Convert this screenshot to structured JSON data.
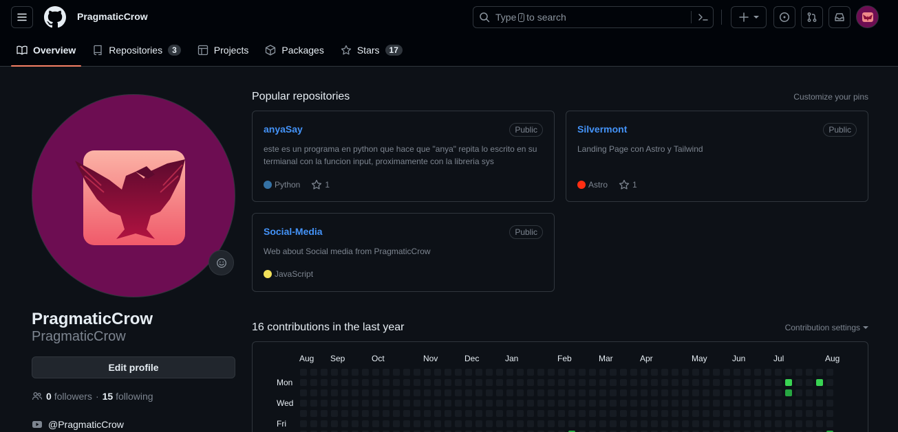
{
  "header": {
    "username": "PragmaticCrow",
    "search_prefix": "Type",
    "search_key": "/",
    "search_suffix": "to search"
  },
  "tabs": [
    {
      "label": "Overview",
      "count": null
    },
    {
      "label": "Repositories",
      "count": "3"
    },
    {
      "label": "Projects",
      "count": null
    },
    {
      "label": "Packages",
      "count": null
    },
    {
      "label": "Stars",
      "count": "17"
    }
  ],
  "profile": {
    "name": "PragmaticCrow",
    "login": "PragmaticCrow",
    "edit_label": "Edit profile",
    "followers": "0",
    "followers_label": "followers",
    "following": "15",
    "following_label": "following",
    "social": "@PragmaticCrow"
  },
  "popular": {
    "title": "Popular repositories",
    "customize": "Customize your pins",
    "repos": [
      {
        "name": "anyaSay",
        "visibility": "Public",
        "description": "este es un programa en python que hace que \"anya\" repita lo escrito en su termianal con la funcion input, proximamente con la libreria sys",
        "language": "Python",
        "lang_color": "#3572a5",
        "stars": "1"
      },
      {
        "name": "Silvermont",
        "visibility": "Public",
        "description": "Landing Page con Astro y Tailwind",
        "language": "Astro",
        "lang_color": "#ff2e12",
        "stars": "1"
      },
      {
        "name": "Social-Media",
        "visibility": "Public",
        "description": "Web about Social media from PragmaticCrow",
        "language": "JavaScript",
        "lang_color": "#f1e05a",
        "stars": null
      }
    ]
  },
  "contributions": {
    "title": "16 contributions in the last year",
    "settings": "Contribution settings",
    "months": [
      "Aug",
      "Sep",
      "Oct",
      "Nov",
      "Dec",
      "Jan",
      "Feb",
      "Mar",
      "Apr",
      "May",
      "Jun",
      "Jul",
      "Aug"
    ],
    "days": [
      "Mon",
      "Wed",
      "Fri"
    ],
    "colors": {
      "empty": "#161b22",
      "level1": "#0e4429",
      "level2": "#006d32",
      "level3": "#26a641",
      "level4": "#39d353"
    }
  }
}
